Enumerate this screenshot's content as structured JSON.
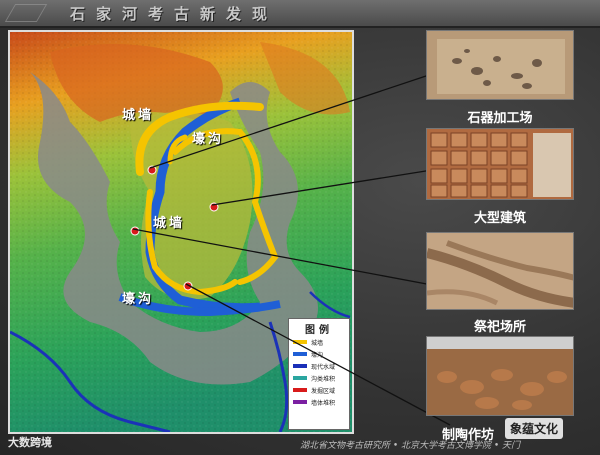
{
  "slide": {
    "title": "石家河考古新发现",
    "footer": "湖北省文物考古研究所 • 北京大学考古文博学院 • 天门"
  },
  "map": {
    "labels": {
      "wall_top": "城墙",
      "moat_top": "壕沟",
      "wall_mid": "城墙",
      "moat_bottom": "壕沟"
    },
    "legend": {
      "title": "图例",
      "items": [
        {
          "label": "城墙",
          "color": "#f5c400"
        },
        {
          "label": "壕沟",
          "color": "#1f5fd6"
        },
        {
          "label": "现代水域",
          "color": "#1a2fb8"
        },
        {
          "label": "沟类堆积",
          "color": "#2aa6a0"
        },
        {
          "label": "发掘区域",
          "color": "#d81b1b"
        },
        {
          "label": "墙体堆积",
          "color": "#7b1fa2"
        }
      ]
    }
  },
  "findings": [
    {
      "caption": "石器加工场"
    },
    {
      "caption": "大型建筑"
    },
    {
      "caption": "祭祀场所"
    },
    {
      "caption": "制陶作坊"
    }
  ],
  "watermarks": {
    "left": "大数跨境",
    "right": "象蕴文化"
  }
}
